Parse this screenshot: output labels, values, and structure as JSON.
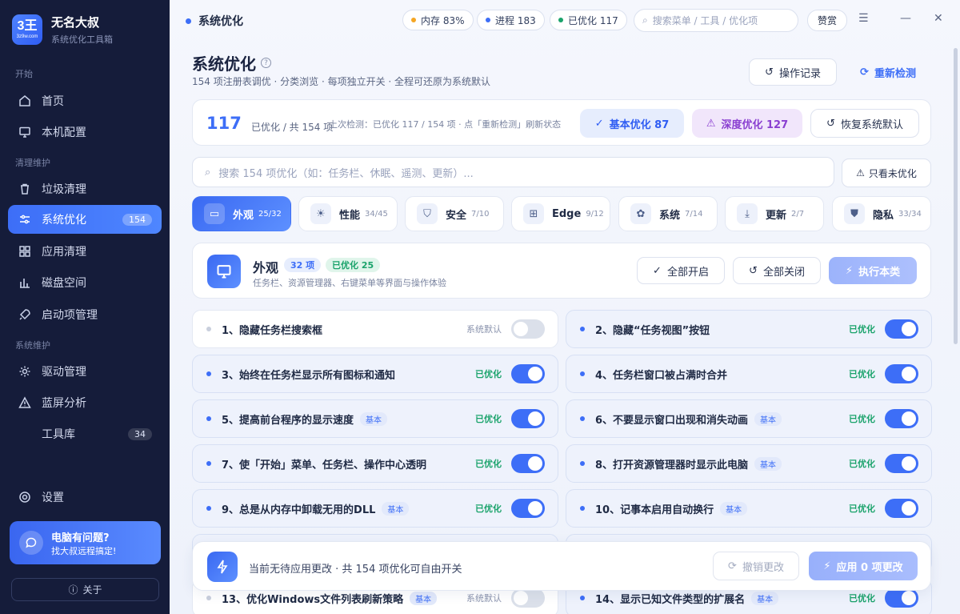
{
  "app": {
    "logo_text": "3王",
    "logo_sub": "3z9w.com",
    "name": "无名大叔",
    "subtitle": "系统优化工具箱"
  },
  "sidebar": {
    "sections": [
      "开始",
      "清理维护",
      "系统维护"
    ],
    "items": [
      {
        "label": "首页",
        "icon": "home-icon"
      },
      {
        "label": "本机配置",
        "icon": "monitor-icon"
      },
      {
        "label": "垃圾清理",
        "icon": "trash-icon"
      },
      {
        "label": "系统优化",
        "icon": "sliders-icon",
        "count": "154",
        "active": true
      },
      {
        "label": "应用清理",
        "icon": "grid-icon"
      },
      {
        "label": "磁盘空间",
        "icon": "bar-chart-icon"
      },
      {
        "label": "启动项管理",
        "icon": "rocket-icon"
      },
      {
        "label": "驱动管理",
        "icon": "gear-icon"
      },
      {
        "label": "蓝屏分析",
        "icon": "warning-icon"
      },
      {
        "label": "工具库",
        "icon": "toolbox-icon",
        "count": "34"
      }
    ],
    "settings": "设置",
    "help": {
      "title": "电脑有问题?",
      "sub": "找大叔远程搞定!"
    },
    "about": "关于"
  },
  "topbar": {
    "title": "系统优化",
    "memory": "内存 83%",
    "process": "进程 183",
    "optimized": "已优化 117",
    "search_placeholder": "搜索菜单 / 工具 / 优化项",
    "donate": "赞赏",
    "colors": {
      "memory": "#f5a623",
      "process": "#3d6ef7",
      "optimized": "#1aa36b"
    }
  },
  "page": {
    "title": "系统优化",
    "subtitle": "154 项注册表调优 · 分类浏览 · 每项独立开关 · 全程可还原为系统默认",
    "history_button": "操作记录",
    "recheck_button": "重新检测"
  },
  "summary": {
    "count": "117",
    "unit": "已优化 / 共 154 项",
    "info": "上次检测：已优化 117 / 154 项 · 点「重新检测」刷新状态",
    "basic": "基本优化 87",
    "deep": "深度优化 127",
    "restore": "恢复系统默认"
  },
  "search": {
    "placeholder": "搜索 154 项优化（如：任务栏、休眠、遥测、更新）...",
    "only_unoptimized": "只看未优化"
  },
  "categories": [
    {
      "name": "外观",
      "count": "25/32",
      "icon": "monitor-icon",
      "active": true
    },
    {
      "name": "性能",
      "count": "34/45",
      "icon": "sun-icon"
    },
    {
      "name": "安全",
      "count": "7/10",
      "icon": "shield-icon"
    },
    {
      "name": "Edge",
      "count": "9/12",
      "icon": "grid-icon"
    },
    {
      "name": "系统",
      "count": "7/14",
      "icon": "palette-icon"
    },
    {
      "name": "更新",
      "count": "2/7",
      "icon": "download-icon"
    },
    {
      "name": "隐私",
      "count": "33/34",
      "icon": "shield-check-icon"
    }
  ],
  "category_header": {
    "name": "外观",
    "total": "32 项",
    "optimized": "已优化 25",
    "desc": "任务栏、资源管理器、右键菜单等界面与操作体验",
    "enable_all": "全部开启",
    "disable_all": "全部关闭",
    "execute": "执行本类"
  },
  "items": [
    {
      "title": "1、隐藏任务栏搜索框",
      "status": "系统默认",
      "on": false
    },
    {
      "title": "2、隐藏“任务视图”按钮",
      "status": "已优化",
      "on": true
    },
    {
      "title": "3、始终在任务栏显示所有图标和通知",
      "status": "已优化",
      "on": true
    },
    {
      "title": "4、任务栏窗口被占满时合并",
      "status": "已优化",
      "on": true
    },
    {
      "title": "5、提高前台程序的显示速度",
      "badge": "基本",
      "status": "已优化",
      "on": true
    },
    {
      "title": "6、不要显示窗口出现和消失动画",
      "badge": "基本",
      "status": "已优化",
      "on": true
    },
    {
      "title": "7、使「开始」菜单、任务栏、操作中心透明",
      "status": "已优化",
      "on": true
    },
    {
      "title": "8、打开资源管理器时显示此电脑",
      "badge": "基本",
      "status": "已优化",
      "on": true
    },
    {
      "title": "9、总是从内存中卸载无用的DLL",
      "badge": "基本",
      "status": "已优化",
      "on": true
    },
    {
      "title": "10、记事本启用自动换行",
      "badge": "基本",
      "status": "已优化",
      "on": true
    },
    {
      "title": "13、优化Windows文件列表刷新策略",
      "badge": "基本",
      "status": "系统默认",
      "on": false
    },
    {
      "title": "14、显示已知文件类型的扩展名",
      "badge": "基本",
      "status": "已优化",
      "on": true
    }
  ],
  "footer": {
    "text": "当前无待应用更改 · 共 154 项优化可自由开关",
    "undo": "撤销更改",
    "apply": "应用 0 项更改"
  }
}
